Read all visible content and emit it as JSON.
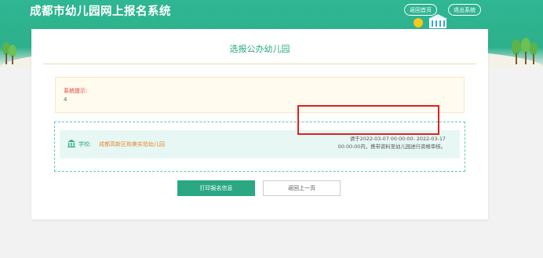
{
  "header": {
    "site_title": "成都市幼儿园网上报名系统",
    "home_button": "返回首页",
    "logout_button": "退出系统"
  },
  "card": {
    "title": "选报公办幼儿园",
    "notice_label": "系统提示:",
    "notice_value": "4",
    "school_label": "学校:",
    "school_name": "成都高新区和美实验幼儿园",
    "school_note": "请于2022-03-07 00:00:00- 2022-03-17 00:00:00内，携带资料至幼儿园进行资格审核。",
    "print_button": "打印报名信息",
    "back_button": "返回上一页"
  },
  "colors": {
    "brand": "#2aa883",
    "notice_bg": "#fffbee",
    "school_name": "#e6862c",
    "alert_red": "#e23b3b",
    "highlight_border": "#e02020"
  },
  "icons": {
    "school": "bank-icon",
    "scenery": [
      "tree-icon",
      "sun-icon",
      "building-icon"
    ]
  }
}
